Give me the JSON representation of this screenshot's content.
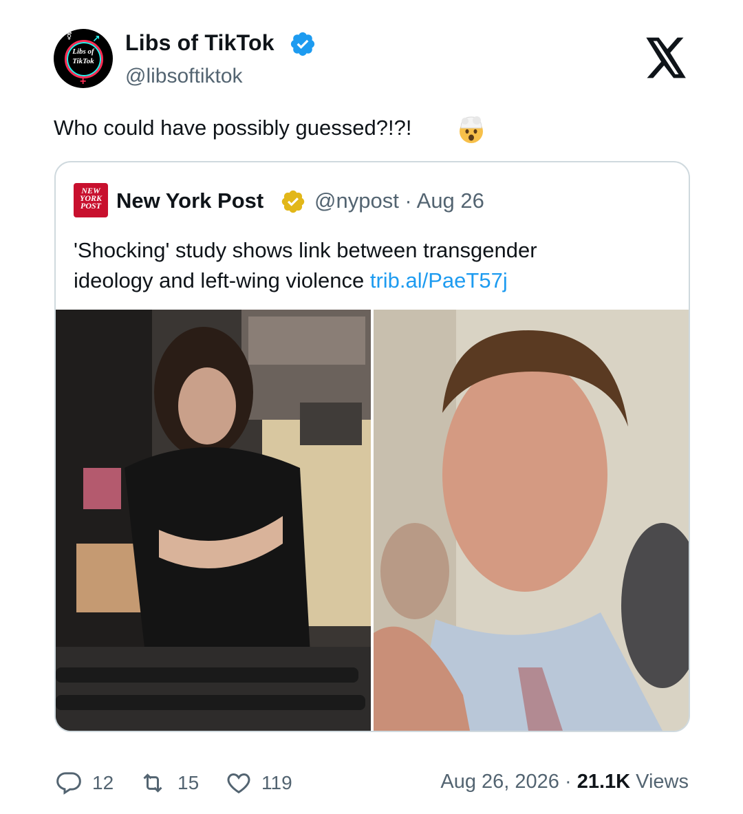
{
  "author": {
    "name": "Libs of TikTok",
    "handle": "@libsoftiktok",
    "avatar_text_1": "Libs of",
    "avatar_text_2": "TikTok"
  },
  "platform_icon": "x-logo-icon",
  "tweet": {
    "text": "Who could have possibly guessed?!?!",
    "emoji": "exploding-head-icon"
  },
  "quoted": {
    "logo_text": "NEW YORK POST",
    "name": "New York Post",
    "meta": "@nypost · Aug 26",
    "text_line1": "'Shocking' study shows link between transgender",
    "text_line2": "ideology and left-wing violence ",
    "link": "trib.al/PaeT57j"
  },
  "stats": {
    "replies": "12",
    "reposts": "15",
    "likes": "119",
    "date": "Aug 26, 2026 · ",
    "views_count": "21.1K",
    "views_label": " Views"
  },
  "colors": {
    "verified_blue": "#1d9bf0",
    "verified_gold": "#e2b719",
    "link": "#1d9bf0",
    "nypost_red": "#c8102e"
  }
}
